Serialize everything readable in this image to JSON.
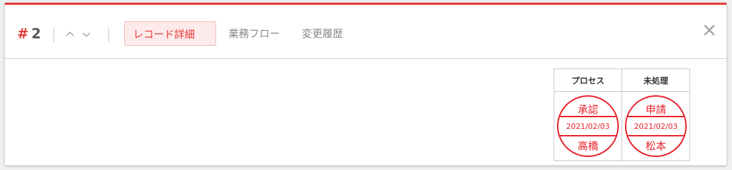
{
  "header": {
    "hash_symbol": "#",
    "record_number": "2",
    "tabs": [
      {
        "label": "レコード詳細",
        "active": true
      },
      {
        "label": "業務フロー",
        "active": false
      },
      {
        "label": "変更履歴",
        "active": false
      }
    ],
    "icons": {
      "prev": "chevron-up-icon",
      "next": "chevron-down-icon",
      "close": "close-icon"
    }
  },
  "stamp_table": {
    "columns": [
      {
        "header": "プロセス",
        "stamp": {
          "top": "承認",
          "date": "2021/02/03",
          "bottom": "高橋"
        }
      },
      {
        "header": "未処理",
        "stamp": {
          "top": "申請",
          "date": "2021/02/03",
          "bottom": "松本"
        }
      }
    ]
  },
  "colors": {
    "accent": "#e53935",
    "stamp_red": "#e8202a",
    "active_tab_bg": "#fdeaea"
  }
}
